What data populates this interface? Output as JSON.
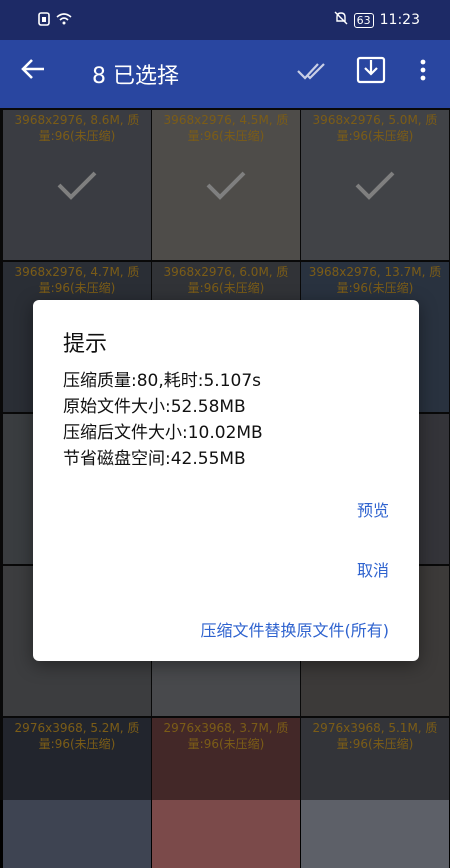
{
  "status_bar": {
    "time": "11:23",
    "battery": "63"
  },
  "app_bar": {
    "title": "8 已选择"
  },
  "tiles": [
    {
      "info": "3968x2976, 8.6M, 质量:96(未压缩)",
      "bg": "#6a6e78",
      "checked": true
    },
    {
      "info": "3968x2976, 4.5M, 质量:96(未压缩)",
      "bg": "#8f8b85",
      "checked": true
    },
    {
      "info": "3968x2976, 5.0M, 质量:96(未压缩)",
      "bg": "#777a82",
      "checked": true
    },
    {
      "info": "3968x2976, 4.7M, 质量:96(未压缩)",
      "bg": "#4d5562",
      "checked": false
    },
    {
      "info": "3968x2976, 6.0M, 质量:96(未压缩)",
      "bg": "#5a5e65",
      "checked": false
    },
    {
      "info": "3968x2976, 13.7M, 质量:96(未压缩)",
      "bg": "#4b5b73",
      "checked": false
    },
    {
      "info": "39",
      "bg": "#6b6f76",
      "checked": false
    },
    {
      "info": "",
      "bg": "#7a7c80",
      "checked": false
    },
    {
      "info": "质",
      "bg": "#5f6068",
      "checked": false
    },
    {
      "info": "29",
      "bg": "#6d6f73",
      "checked": false
    },
    {
      "info": "",
      "bg": "#83868a",
      "checked": false
    },
    {
      "info": "质",
      "bg": "#6e6b68",
      "checked": false
    },
    {
      "info": "2976x3968, 5.2M, 质量:96(未压缩)",
      "bg": "#3e4452",
      "checked": false
    },
    {
      "info": "2976x3968, 3.7M, 质量:96(未压缩)",
      "bg": "#7b4a4a",
      "checked": false
    },
    {
      "info": "2976x3968, 5.1M, 质量:96(未压缩)",
      "bg": "#5d6068",
      "checked": false
    }
  ],
  "dialog": {
    "title": "提示",
    "lines": [
      "压缩质量:80,耗时:5.107s",
      "原始文件大小:52.58MB",
      "压缩后文件大小:10.02MB",
      "节省磁盘空间:42.55MB"
    ],
    "preview_label": "预览",
    "cancel_label": "取消",
    "replace_label": "压缩文件替换原文件(所有)"
  }
}
